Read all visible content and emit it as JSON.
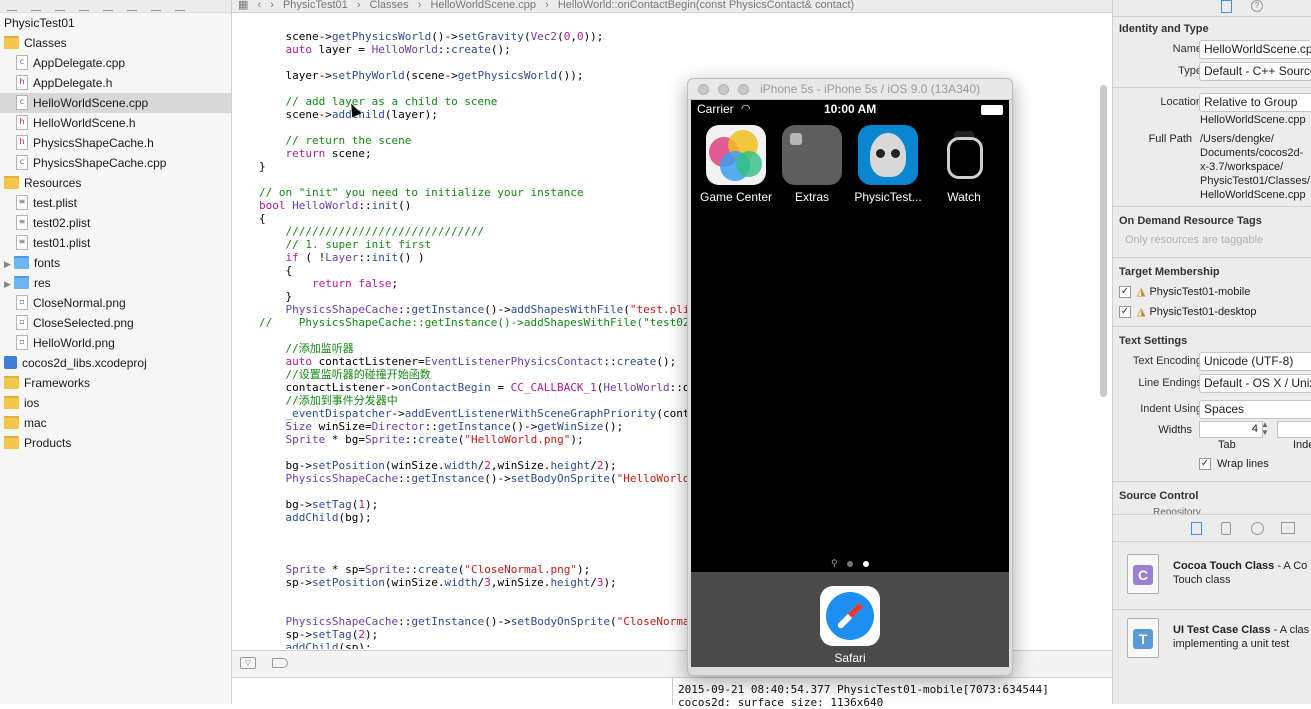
{
  "navigator": {
    "items": [
      {
        "label": "PhysicTest01",
        "type": "project-root",
        "indent": 0
      },
      {
        "label": "Classes",
        "type": "folder",
        "indent": 0
      },
      {
        "label": "AppDelegate.cpp",
        "type": "cpp",
        "indent": 1
      },
      {
        "label": "AppDelegate.h",
        "type": "h",
        "indent": 1
      },
      {
        "label": "HelloWorldScene.cpp",
        "type": "cpp",
        "indent": 1,
        "selected": true
      },
      {
        "label": "HelloWorldScene.h",
        "type": "h",
        "indent": 1
      },
      {
        "label": "PhysicsShapeCache.h",
        "type": "h",
        "indent": 1
      },
      {
        "label": "PhysicsShapeCache.cpp",
        "type": "cpp",
        "indent": 1
      },
      {
        "label": "Resources",
        "type": "folder",
        "indent": 0
      },
      {
        "label": "test.plist",
        "type": "plist",
        "indent": 1
      },
      {
        "label": "test02.plist",
        "type": "plist",
        "indent": 1
      },
      {
        "label": "test01.plist",
        "type": "plist",
        "indent": 1
      },
      {
        "label": "fonts",
        "type": "bluefolder",
        "indent": 1,
        "disclosure": true
      },
      {
        "label": "res",
        "type": "bluefolder",
        "indent": 1,
        "disclosure": true
      },
      {
        "label": "CloseNormal.png",
        "type": "png",
        "indent": 1
      },
      {
        "label": "CloseSelected.png",
        "type": "png",
        "indent": 1
      },
      {
        "label": "HelloWorld.png",
        "type": "png",
        "indent": 1
      },
      {
        "label": "cocos2d_libs.xcodeproj",
        "type": "xcodeproj",
        "indent": 0
      },
      {
        "label": "Frameworks",
        "type": "folder",
        "indent": 0
      },
      {
        "label": "ios",
        "type": "folder",
        "indent": 0
      },
      {
        "label": "mac",
        "type": "folder",
        "indent": 0
      },
      {
        "label": "Products",
        "type": "folder",
        "indent": 0
      }
    ]
  },
  "pathbar": {
    "segments": [
      "PhysicTest01",
      "Classes",
      "HelloWorldScene.cpp",
      "HelloWorld::onContactBegin(const PhysicsContact& contact)"
    ]
  },
  "console": {
    "lines": [
      "2015-09-21 08:40:54.377 PhysicTest01-mobile[7073:634544]",
      "cocos2d: surface size: 1136x640"
    ]
  },
  "simulator": {
    "title": "iPhone 5s - iPhone 5s / iOS 9.0 (13A340)",
    "carrier": "Carrier",
    "time": "10:00 AM",
    "apps": [
      "Game Center",
      "Extras",
      "PhysicTest...",
      "Watch"
    ],
    "dock_app": "Safari"
  },
  "inspector": {
    "identity_header": "Identity and Type",
    "name_label": "Name",
    "name_value": "HelloWorldScene.cpp",
    "type_label": "Type",
    "type_value": "Default - C++ Source",
    "location_label": "Location",
    "location_value": "Relative to Group",
    "location_file": "HelloWorldScene.cpp",
    "fullpath_label": "Full Path",
    "fullpath_lines": [
      "/Users/dengke/",
      "Documents/cocos2d-",
      "x-3.7/workspace/",
      "PhysicTest01/Classes/",
      "HelloWorldScene.cpp"
    ],
    "odr_header": "On Demand Resource Tags",
    "odr_placeholder": "Only resources are taggable",
    "target_header": "Target Membership",
    "targets": [
      "PhysicTest01-mobile",
      "PhysicTest01-desktop"
    ],
    "text_header": "Text Settings",
    "encoding_label": "Text Encoding",
    "encoding_value": "Unicode (UTF-8)",
    "endings_label": "Line Endings",
    "endings_value": "Default - OS X / Unix",
    "indent_label": "Indent Using",
    "indent_value": "Spaces",
    "widths_label": "Widths",
    "tab_value": "4",
    "tab_label": "Tab",
    "indent_short": "Inde",
    "wrap_label": "Wrap lines",
    "source_header": "Source Control",
    "repository_label": "Repository",
    "library": [
      {
        "title": "Cocoa Touch Class",
        "desc1": " - A Co",
        "desc2": "Touch class",
        "letter": "C",
        "color": "#9b7fd3"
      },
      {
        "title": "UI Test Case Class",
        "desc1": " - A clas",
        "desc2": "implementing a unit test",
        "letter": "T",
        "color": "#5b9ad8"
      }
    ]
  }
}
